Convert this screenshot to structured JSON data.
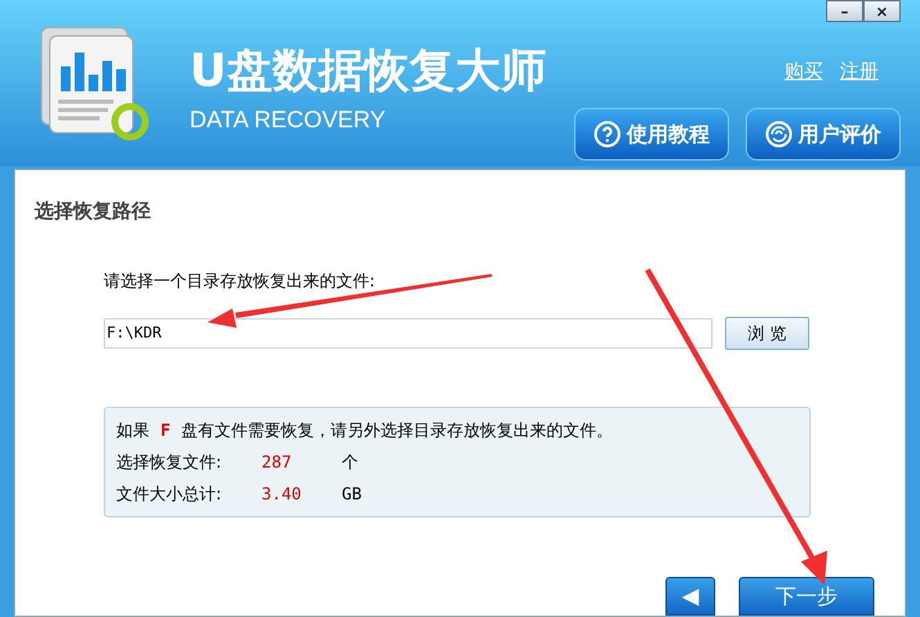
{
  "header": {
    "title": "U盘数据恢复大师",
    "subtitle": "DATA RECOVERY",
    "links": [
      "购买",
      "注册"
    ],
    "buttons": [
      {
        "label": "使用教程",
        "kind": "help"
      },
      {
        "label": "用户评价",
        "kind": "review"
      }
    ],
    "window_controls": [
      "–",
      "×"
    ]
  },
  "section_title": "选择恢复路径",
  "path": {
    "label": "请选择一个目录存放恢复出来的文件:",
    "value": "F:\\KDR",
    "browse": "浏 览"
  },
  "info": {
    "before": "如果",
    "drive": "F",
    "after": "盘有文件需要恢复，请另外选择目录存放恢复出来的文件。",
    "rows": [
      {
        "label": "选择恢复文件:",
        "value": "287",
        "unit": "个"
      },
      {
        "label": "文件大小总计:",
        "value": "3.40",
        "unit": "GB"
      }
    ]
  },
  "footer": {
    "back": "◀",
    "next": "下一步"
  }
}
